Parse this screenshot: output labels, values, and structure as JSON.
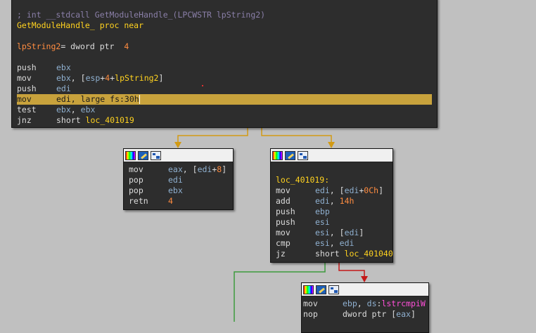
{
  "top_block": {
    "comment": "; int __stdcall GetModuleHandle_(LPCWSTR lpString2)",
    "proc_name": "GetModuleHandle_",
    "proc_kw": "proc near",
    "arg_name": "lpString2",
    "arg_decl": "= dword ptr",
    "arg_off": "4",
    "instructions": [
      {
        "m": "push",
        "o": [
          [
            "r",
            "ebx"
          ]
        ]
      },
      {
        "m": "mov",
        "o": [
          [
            "r",
            "ebx"
          ],
          [
            "t",
            ", ["
          ],
          [
            "r",
            "esp"
          ],
          [
            "t",
            "+"
          ],
          [
            "n",
            "4"
          ],
          [
            "t",
            "+"
          ],
          [
            "l",
            "lpString2"
          ],
          [
            "t",
            "]"
          ]
        ]
      },
      {
        "m": "push",
        "o": [
          [
            "r",
            "edi"
          ]
        ]
      },
      {
        "m": "mov",
        "o": [
          [
            "t",
            "edi, large fs:30h"
          ]
        ],
        "hl": true
      },
      {
        "m": "test",
        "o": [
          [
            "r",
            "ebx"
          ],
          [
            "t",
            ", "
          ],
          [
            "r",
            "ebx"
          ]
        ]
      },
      {
        "m": "jnz",
        "o": [
          [
            "t",
            "short "
          ],
          [
            "l",
            "loc_401019"
          ]
        ]
      }
    ]
  },
  "left_block": {
    "instructions": [
      {
        "m": "mov",
        "o": [
          [
            "r",
            "eax"
          ],
          [
            "t",
            ", ["
          ],
          [
            "r",
            "edi"
          ],
          [
            "t",
            "+"
          ],
          [
            "n",
            "8"
          ],
          [
            "t",
            "]"
          ]
        ]
      },
      {
        "m": "pop",
        "o": [
          [
            "r",
            "edi"
          ]
        ]
      },
      {
        "m": "pop",
        "o": [
          [
            "r",
            "ebx"
          ]
        ]
      },
      {
        "m": "retn",
        "o": [
          [
            "n",
            "4"
          ]
        ]
      }
    ]
  },
  "right_block": {
    "label": "loc_401019:",
    "instructions": [
      {
        "m": "mov",
        "o": [
          [
            "r",
            "edi"
          ],
          [
            "t",
            ", ["
          ],
          [
            "r",
            "edi"
          ],
          [
            "t",
            "+"
          ],
          [
            "n",
            "0Ch"
          ],
          [
            "t",
            "]"
          ]
        ]
      },
      {
        "m": "add",
        "o": [
          [
            "r",
            "edi"
          ],
          [
            "t",
            ", "
          ],
          [
            "n",
            "14h"
          ]
        ]
      },
      {
        "m": "push",
        "o": [
          [
            "r",
            "ebp"
          ]
        ]
      },
      {
        "m": "push",
        "o": [
          [
            "r",
            "esi"
          ]
        ]
      },
      {
        "m": "mov",
        "o": [
          [
            "r",
            "esi"
          ],
          [
            "t",
            ", ["
          ],
          [
            "r",
            "edi"
          ],
          [
            "t",
            "]"
          ]
        ]
      },
      {
        "m": "cmp",
        "o": [
          [
            "r",
            "esi"
          ],
          [
            "t",
            ", "
          ],
          [
            "r",
            "edi"
          ]
        ]
      },
      {
        "m": "jz",
        "o": [
          [
            "t",
            "short "
          ],
          [
            "l",
            "loc_401040"
          ]
        ]
      }
    ]
  },
  "bottom_block": {
    "instructions": [
      {
        "m": "mov",
        "o": [
          [
            "r",
            "ebp"
          ],
          [
            "t",
            ", "
          ],
          [
            "r",
            "ds"
          ],
          [
            "t",
            ":"
          ],
          [
            "p",
            "lstrcmpiW"
          ]
        ]
      },
      {
        "m": "nop",
        "o": [
          [
            "t",
            "dword ptr ["
          ],
          [
            "r",
            "eax"
          ],
          [
            "t",
            "]"
          ]
        ]
      }
    ]
  },
  "colors": {
    "background": "#c0c0c0",
    "block_bg": "#2d2d2d",
    "register": "#8fb0d0",
    "number": "#ff8c40",
    "label": "#ffd21f",
    "comment": "#8a7fa8",
    "import": "#ff4fd8",
    "edge_yellow": "#d29a14",
    "edge_red": "#c41818",
    "edge_green": "#3d9a3d",
    "highlight": "#c8a23c"
  },
  "icons": [
    "color-icon",
    "pencil-icon",
    "graph-icon"
  ]
}
